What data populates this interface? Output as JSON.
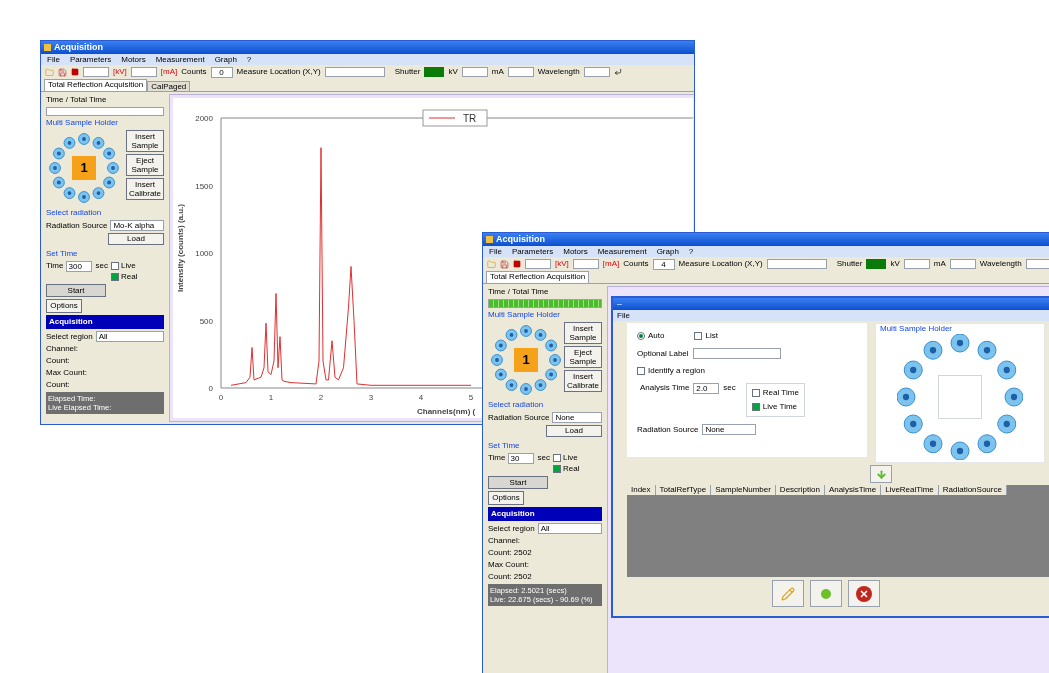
{
  "windows": [
    {
      "title": "Acquisition",
      "menu": [
        "File",
        "Parameters",
        "Motors",
        "Measurement",
        "Graph",
        "?"
      ],
      "toolbar": {
        "unit_labels": [
          "[kV]",
          "[mA]"
        ],
        "counts_label": "Counts",
        "counts_value": "0",
        "location_label": "Measure Location (X,Y)",
        "shutter_label": "Shutter",
        "kv_label": "kV",
        "ma_label": "mA",
        "wavelength_label": "Wavelength"
      },
      "tabs": [
        {
          "label": "Total Reflection Acquisition",
          "selected": true
        },
        {
          "label": "CalPaged",
          "selected": false
        }
      ],
      "left": {
        "time_label": "Time / Total Time",
        "time_progress": {
          "level": 0
        },
        "holder_label": "Multi Sample Holder",
        "sample_number": "1",
        "holder_buttons": [
          "Insert Sample",
          "Eject Sample",
          "Insert Calibrate"
        ],
        "radiation_label": "Select radiation",
        "radiation": {
          "label": "Radiation Source",
          "value": "Mo-K alpha"
        },
        "load_button": "Load",
        "set_time_label": "Set Time",
        "time": {
          "label": "Time",
          "value": "300",
          "unit": "sec"
        },
        "modes": [
          {
            "label": "Live",
            "checked": false
          },
          {
            "label": "Real",
            "checked": true
          }
        ],
        "start_button": "Start",
        "options_button": "Options",
        "acquisition_header": "Acquisition",
        "region": {
          "label": "Select region",
          "value": "All"
        },
        "readouts": [
          "Channel:",
          "Count:",
          "Max Count:",
          "Count:"
        ],
        "status_lines": [
          "Elapsed Time:",
          "Live Elapsed Time:"
        ]
      },
      "chart": {
        "chart_data": {
          "type": "line",
          "xlabel": "Channels(nm) (",
          "ylabel": "Intensity (counts) (a.u.)",
          "x": [
            0.2,
            0.5,
            0.58,
            0.62,
            0.66,
            0.8,
            0.86,
            0.9,
            0.94,
            1.0,
            1.06,
            1.1,
            1.14,
            1.18,
            1.22,
            1.26,
            1.4,
            1.9,
            1.96,
            2.0,
            2.04,
            2.1,
            2.15,
            2.22,
            2.28,
            2.35,
            2.45,
            2.55,
            2.6,
            2.66,
            2.72,
            3.0,
            4.0,
            5.0
          ],
          "series": [
            {
              "name": "TR",
              "color": "#e03030",
              "values": [
                20,
                40,
                80,
                300,
                60,
                80,
                150,
                480,
                120,
                100,
                200,
                700,
                150,
                380,
                60,
                50,
                40,
                30,
                200,
                1780,
                200,
                60,
                60,
                350,
                80,
                60,
                150,
                600,
                900,
                500,
                30,
                20,
                20,
                20
              ]
            }
          ],
          "xticks": [
            0,
            1,
            2,
            3,
            4,
            5
          ],
          "yticks": [
            0,
            500,
            1000,
            1500,
            2000
          ],
          "xlim": [
            0,
            6
          ],
          "ylim": [
            0,
            2000
          ]
        }
      }
    },
    {
      "title": "Acquisition",
      "menu": [
        "File",
        "Parameters",
        "Motors",
        "Measurement",
        "Graph",
        "?"
      ],
      "toolbar": {
        "unit_labels": [
          "[kV]",
          "[mA]"
        ],
        "counts_label": "Counts",
        "counts_value": "4",
        "location_label": "Measure Location (X,Y)",
        "shutter_label": "Shutter",
        "kv_label": "kV",
        "ma_label": "mA",
        "wavelength_label": "Wavelength"
      },
      "tabs": [
        {
          "label": "Total Reflection Acquisition",
          "selected": true
        }
      ],
      "left": {
        "time_label": "Time / Total Time",
        "time_progress": {
          "level": 1
        },
        "holder_label": "Multi Sample Holder",
        "sample_number": "1",
        "holder_buttons": [
          "Insert Sample",
          "Eject Sample",
          "Insert Calibrate"
        ],
        "radiation_label": "Select radiation",
        "radiation": {
          "label": "Radiation Source",
          "value": "None"
        },
        "load_button": "Load",
        "set_time_label": "Set Time",
        "time": {
          "label": "Time",
          "value": "30",
          "unit": "sec"
        },
        "modes": [
          {
            "label": "Live",
            "checked": false
          },
          {
            "label": "Real",
            "checked": true
          }
        ],
        "start_button": "Start",
        "options_button": "Options",
        "acquisition_header": "Acquisition",
        "region": {
          "label": "Select region",
          "value": "All"
        },
        "readouts": [
          "Channel:",
          "Count: 2502",
          "Max Count:",
          "Count: 2502"
        ],
        "status_lines": [
          "Elapsed: 2.5021 (secs)",
          "Live: 22.675 (secs) - 90.69 (%)"
        ]
      },
      "dialog": {
        "menu": [
          "File"
        ],
        "options": [
          {
            "label": "Auto",
            "kind": "radio",
            "checked": true
          },
          {
            "label": "List",
            "kind": "checkbox",
            "checked": false
          }
        ],
        "optional_label": "Optional Label",
        "identify": {
          "label": "Identify a region",
          "checked": false
        },
        "analysis": {
          "label": "Analysis Time",
          "value": "2.0",
          "unit": "sec"
        },
        "time_modes": [
          {
            "label": "Real Time",
            "checked": false
          },
          {
            "label": "Live Time",
            "checked": true
          }
        ],
        "radiation": {
          "label": "Radiation Source",
          "value": "None"
        },
        "holder_label": "Multi Sample Holder",
        "columns": [
          "Index",
          "TotalRefType",
          "SampleNumber",
          "Description",
          "AnalysisTime",
          "LiveRealTime",
          "RadiationSource"
        ]
      }
    }
  ]
}
